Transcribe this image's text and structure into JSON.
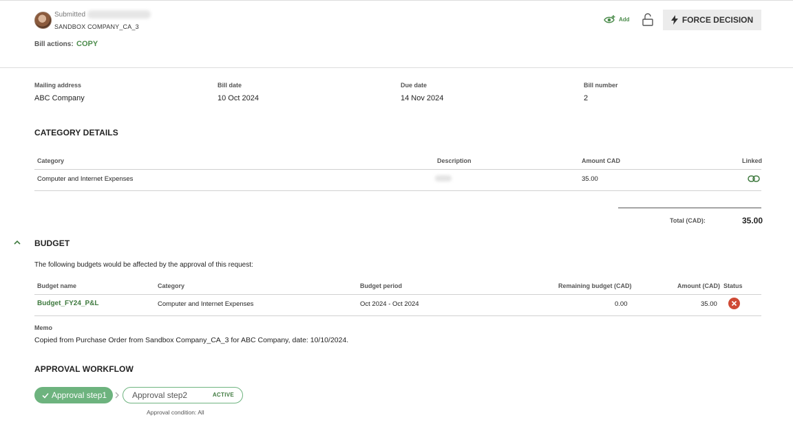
{
  "header": {
    "submitted_label": "Submitted",
    "company": "SANDBOX COMPANY_CA_3",
    "bill_actions_label": "Bill actions:",
    "copy_label": "COPY",
    "add_watcher_label": "Add",
    "force_decision_label": "FORCE DECISION"
  },
  "fields": {
    "mailing_address": {
      "label": "Mailing address",
      "value": "ABC Company"
    },
    "bill_date": {
      "label": "Bill date",
      "value": "10 Oct 2024"
    },
    "due_date": {
      "label": "Due date",
      "value": "14 Nov 2024"
    },
    "bill_number": {
      "label": "Bill number",
      "value": "2"
    }
  },
  "category_details": {
    "title": "CATEGORY DETAILS",
    "columns": {
      "category": "Category",
      "description": "Description",
      "amount": "Amount CAD",
      "linked": "Linked"
    },
    "rows": [
      {
        "category": "Computer and Internet Expenses",
        "amount": "35.00"
      }
    ],
    "total_label": "Total (CAD):",
    "total_value": "35.00"
  },
  "budget": {
    "title": "BUDGET",
    "intro": "The following budgets would be affected by the approval of this request:",
    "columns": {
      "name": "Budget name",
      "category": "Category",
      "period": "Budget period",
      "remaining": "Remaining budget (CAD)",
      "amount": "Amount (CAD)",
      "status": "Status"
    },
    "rows": [
      {
        "name": "Budget_FY24_P&L",
        "category": "Computer and Internet Expenses",
        "period": "Oct 2024 - Oct 2024",
        "remaining": "0.00",
        "amount": "35.00"
      }
    ]
  },
  "memo": {
    "label": "Memo",
    "value": "Copied from Purchase Order from Sandbox Company_CA_3 for ABC Company, date: 10/10/2024."
  },
  "approval_workflow": {
    "title": "APPROVAL WORKFLOW",
    "steps": [
      {
        "label": "Approval step1"
      },
      {
        "label": "Approval step2",
        "badge": "ACTIVE"
      }
    ],
    "condition": "Approval condition: All"
  },
  "colors": {
    "accent_green": "#4c8c4c",
    "step_done": "#6db37e",
    "error_red": "#cf4a35"
  },
  "icons": [
    "eye-add-icon",
    "unlock-icon",
    "lightning-icon",
    "link-icon",
    "chevron-up-icon",
    "close-circle-icon",
    "check-icon",
    "chevron-right-icon"
  ]
}
